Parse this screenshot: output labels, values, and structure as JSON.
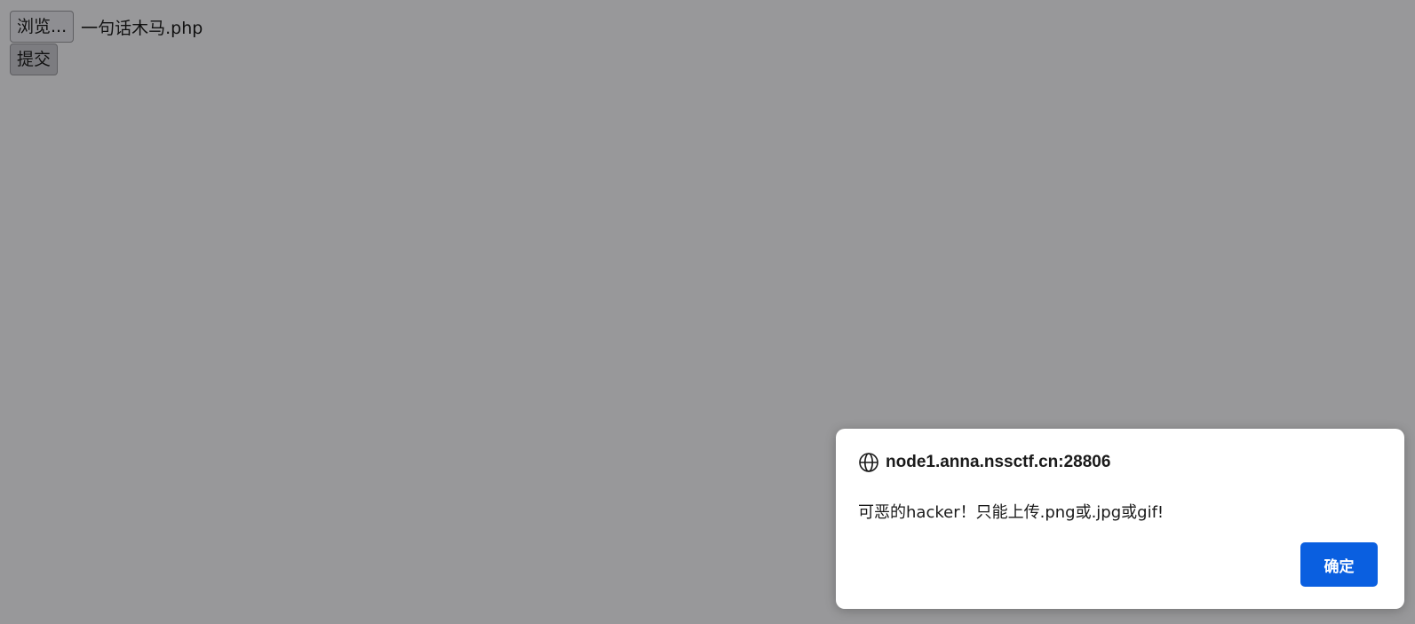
{
  "form": {
    "browse_label": "浏览...",
    "file_name": "一句话木马.php",
    "submit_label": "提交"
  },
  "dialog": {
    "icon": "globe-icon",
    "origin": "node1.anna.nssctf.cn:28806",
    "message": "可恶的hacker！只能上传.png或.jpg或gif!",
    "ok_label": "确定",
    "accent_color": "#0a5fe0"
  },
  "colors": {
    "overlay_background": "#98989a",
    "dialog_background": "#ffffff"
  }
}
